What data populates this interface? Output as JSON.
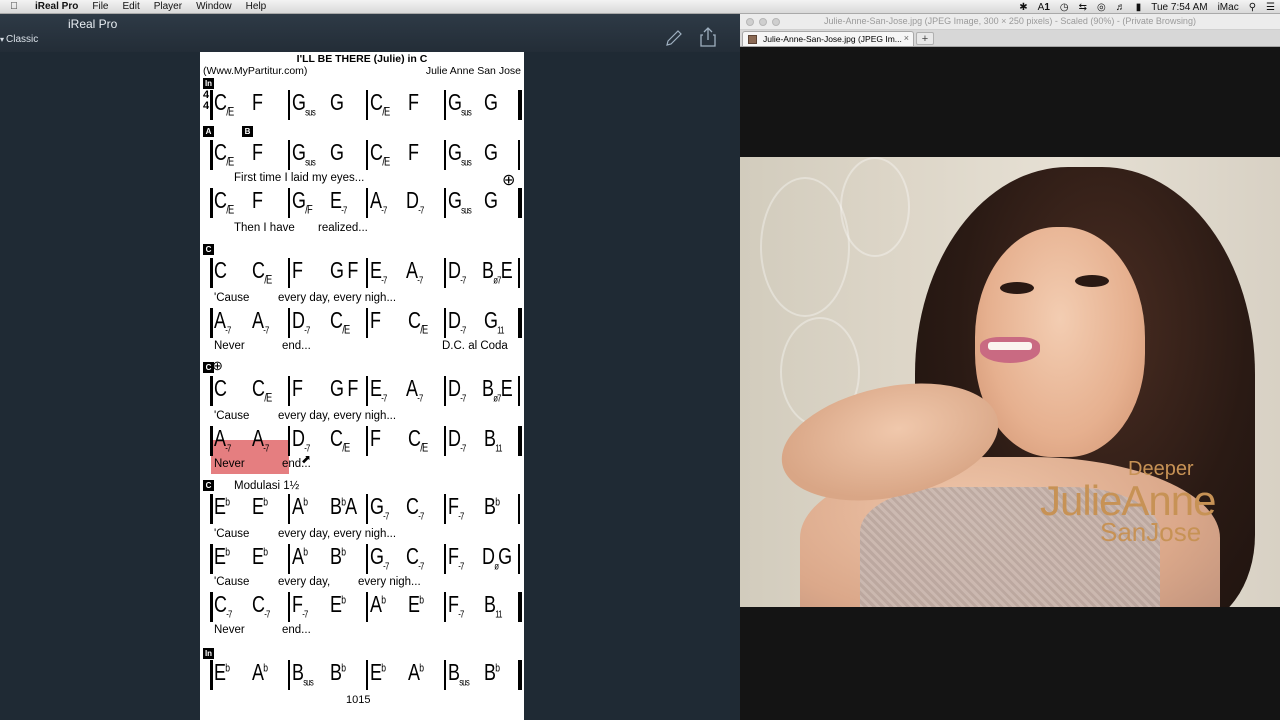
{
  "menubar": {
    "app_name": "iReal Pro",
    "items": [
      "File",
      "Edit",
      "Player",
      "Window",
      "Help"
    ],
    "clock": "Tue 7:54 AM",
    "user": "iMac",
    "status_a1": "1"
  },
  "ireal": {
    "title": "iReal Pro",
    "style": "Classic",
    "song": {
      "title": "I'LL BE THERE (Julie) in C",
      "source": "(Www.MyPartitur.com)",
      "composer": "Julie Anne San Jose",
      "time_signature": [
        "4",
        "4"
      ],
      "modulation_note": "Modulasi 1½",
      "dc_note": "D.C. al Coda",
      "bar_number": "1015",
      "section_labels": [
        "In",
        "A",
        "B",
        "C",
        "C",
        "C",
        "In"
      ],
      "lyrics": [
        "First time I laid my eyes...",
        "Then I have",
        "realized...",
        "'Cause",
        "every day, every nigh...",
        "Never",
        "end...",
        "'Cause",
        "every day, every nigh...",
        "Never",
        "end...",
        "'Cause",
        "every day, every nigh...",
        "'Cause",
        "every day,",
        "every nigh...",
        "Never",
        "end..."
      ]
    }
  },
  "browser": {
    "window_title": "Julie-Anne-San-Jose.jpg (JPEG Image, 300 × 250 pixels) - Scaled (90%) - (Private Browsing)",
    "tab_label": "Julie-Anne-San-Jose.jpg (JPEG Im...",
    "album": {
      "line1": "Deeper",
      "line2": "JulieAnne",
      "line3": "SanJose"
    }
  }
}
